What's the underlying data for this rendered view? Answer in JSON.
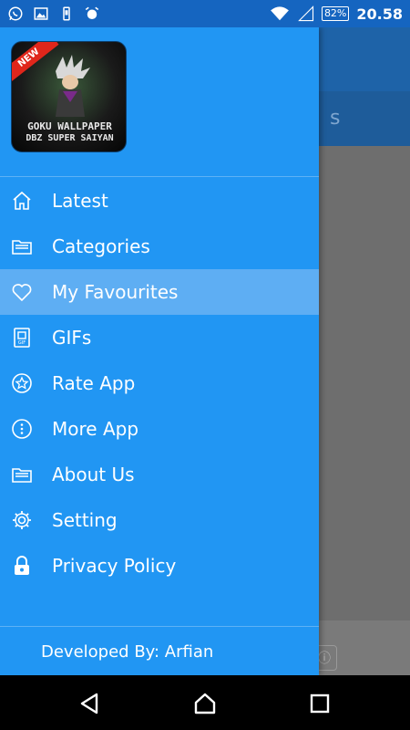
{
  "status_bar": {
    "battery": "82%",
    "time": "20.58"
  },
  "background": {
    "tab_fragment": "s"
  },
  "drawer": {
    "logo": {
      "badge": "NEW",
      "title_line1": "GOKU WALLPAPER",
      "title_line2": "DBZ SUPER SAIYAN"
    },
    "items": [
      {
        "label": "Latest",
        "icon": "home-icon"
      },
      {
        "label": "Categories",
        "icon": "folder-icon"
      },
      {
        "label": "My Favourites",
        "icon": "heart-icon",
        "selected": true
      },
      {
        "label": "GIFs",
        "icon": "gif-file-icon"
      },
      {
        "label": "Rate App",
        "icon": "star-circle-icon"
      },
      {
        "label": "More App",
        "icon": "more-circle-icon"
      },
      {
        "label": "About Us",
        "icon": "folder-icon"
      },
      {
        "label": "Setting",
        "icon": "gear-icon"
      },
      {
        "label": "Privacy Policy",
        "icon": "lock-icon"
      }
    ],
    "footer": "Developed By: Arfian"
  },
  "colors": {
    "drawer_bg": "#2196f3",
    "selected_bg": "#5eaef3",
    "status_bar_bg": "#1565c0"
  }
}
